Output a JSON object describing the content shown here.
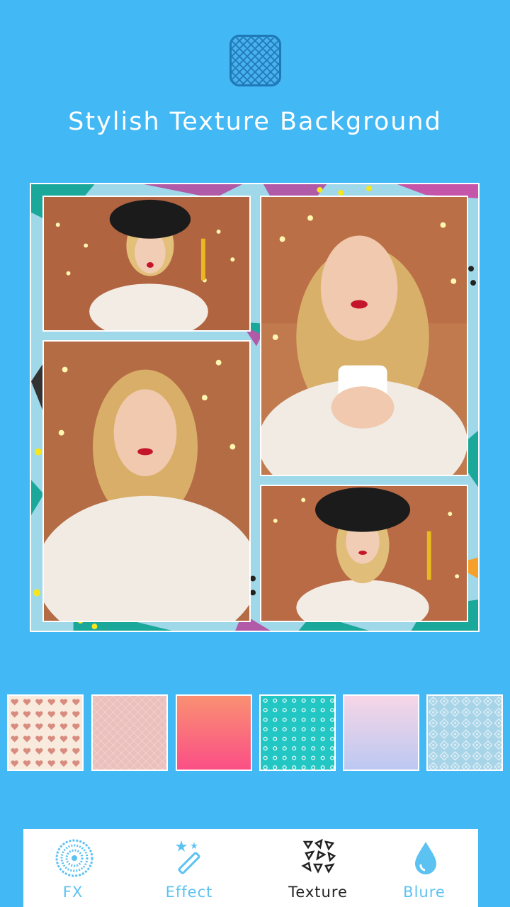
{
  "header": {
    "icon": "texture-pattern-icon",
    "title": "Stylish Texture Background"
  },
  "collage": {
    "photos": [
      "photo-1",
      "photo-2",
      "photo-3",
      "photo-4"
    ]
  },
  "textures": [
    "hearts-texture",
    "pink-grid-texture",
    "coral-gradient-texture",
    "teal-dots-texture",
    "lavender-gradient-texture",
    "blue-pattern-texture"
  ],
  "toolbar": {
    "items": [
      {
        "label": "FX",
        "icon": "fx-circle-icon"
      },
      {
        "label": "Effect",
        "icon": "magic-wand-icon"
      },
      {
        "label": "Texture",
        "icon": "triangles-texture-icon"
      },
      {
        "label": "Blure",
        "icon": "water-drop-icon"
      }
    ],
    "active": "Texture"
  },
  "colors": {
    "background": "#42b8f5",
    "accent": "#5cc2f2",
    "active_label": "#222222"
  }
}
